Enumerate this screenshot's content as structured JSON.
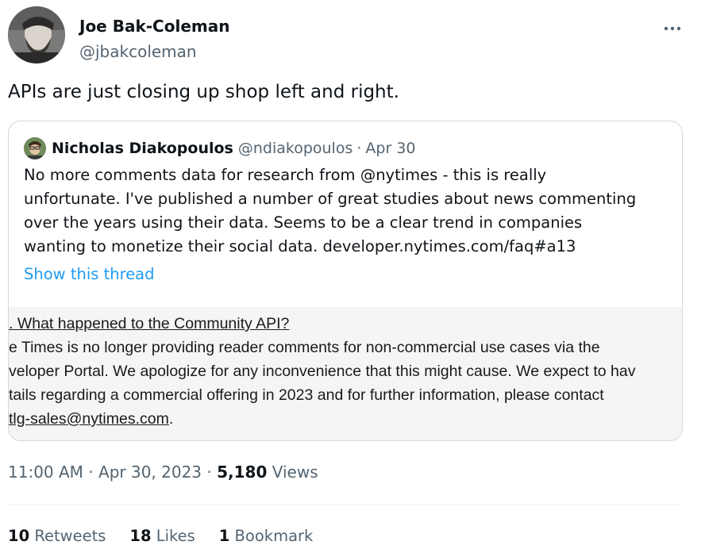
{
  "author": {
    "name": "Joe Bak-Coleman",
    "handle": "@jbakcoleman"
  },
  "tweet_text": "APIs are just closing up shop left and right.",
  "quoted_tweet": {
    "name": "Nicholas Diakopoulos",
    "handle": "@ndiakopoulos",
    "dot": "·",
    "date": "Apr 30",
    "lines": [
      "No more comments data for research from @nytimes - this is really",
      "unfortunate. I've published a number of great studies about news commenting",
      "over the years using their data. Seems to be a clear trend in companies",
      "wanting to monetize their social data. developer.nytimes.com/faq#a13"
    ],
    "show_thread": "Show this thread",
    "image_lines": [
      ". What happened to the Community API?",
      "e Times is no longer providing reader comments for non-commercial use cases via the",
      "veloper Portal. We apologize for any inconvenience that this might cause. We expect to hav",
      "tails regarding a commercial offering in 2023 and for further information, please contact",
      "tlg-sales@nytimes.com",
      "."
    ]
  },
  "meta": {
    "time": "11:00 AM",
    "sep1": " · ",
    "date": "Apr 30, 2023",
    "sep2": " · ",
    "views_count": "5,180",
    "views_label": " Views"
  },
  "stats": {
    "retweets_count": "10",
    "retweets_label": " Retweets",
    "likes_count": "18",
    "likes_label": " Likes",
    "bookmarks_count": "1",
    "bookmarks_label": " Bookmark"
  },
  "colors": {
    "text": "#0f1419",
    "secondary": "#536471",
    "link": "#1d9bf0",
    "border": "#cfd9de"
  },
  "icons": {
    "more": "more-horizontal-icon"
  }
}
